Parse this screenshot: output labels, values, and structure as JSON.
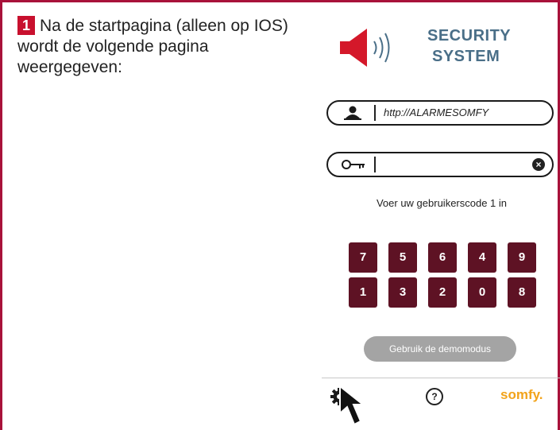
{
  "instruction": {
    "number": "1",
    "text": "Na de startpagina (alleen op IOS) wordt de volgende pagina weergegeven:"
  },
  "logo": {
    "line1": "SECURITY",
    "line2": "SYSTEM",
    "icon": "speaker-icon"
  },
  "url_field": {
    "value": "http://ALARMESOMFY",
    "icon": "user-icon"
  },
  "code_field": {
    "value": "",
    "icon": "key-icon",
    "clear": "×"
  },
  "prompt": "Voer uw gebruikerscode 1 in",
  "keypad": {
    "row1": [
      "7",
      "5",
      "6",
      "4",
      "9"
    ],
    "row2": [
      "1",
      "3",
      "2",
      "0",
      "8"
    ]
  },
  "demo_button": "Gebruik de demomodus",
  "footer": {
    "settings_icon": "gear-icon",
    "help": "?",
    "brand": "somfy."
  },
  "colors": {
    "frame": "#a8123a",
    "step_badge": "#c8102e",
    "key": "#5e1224",
    "logo_text": "#4a6f88",
    "speaker": "#d4182a",
    "brand": "#f2a31b",
    "demo_button": "#a4a4a4"
  }
}
